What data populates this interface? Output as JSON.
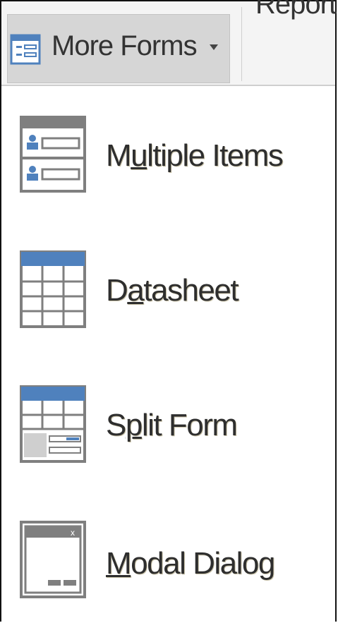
{
  "ribbon": {
    "more_forms_label": "More Forms",
    "report_label": "Report"
  },
  "menu": {
    "items": [
      {
        "pre": "M",
        "key": "u",
        "post": "ltiple Items",
        "icon": "multiple-items-icon"
      },
      {
        "pre": "D",
        "key": "a",
        "post": "tasheet",
        "icon": "datasheet-icon"
      },
      {
        "pre": "S",
        "key": "p",
        "post": "lit Form",
        "icon": "split-form-icon"
      },
      {
        "pre": "",
        "key": "M",
        "post": "odal Dialog",
        "icon": "modal-dialog-icon"
      }
    ]
  },
  "colors": {
    "accent_blue": "#4f81bd",
    "icon_gray": "#7f7f7f",
    "button_hover": "#d6d6d6"
  }
}
